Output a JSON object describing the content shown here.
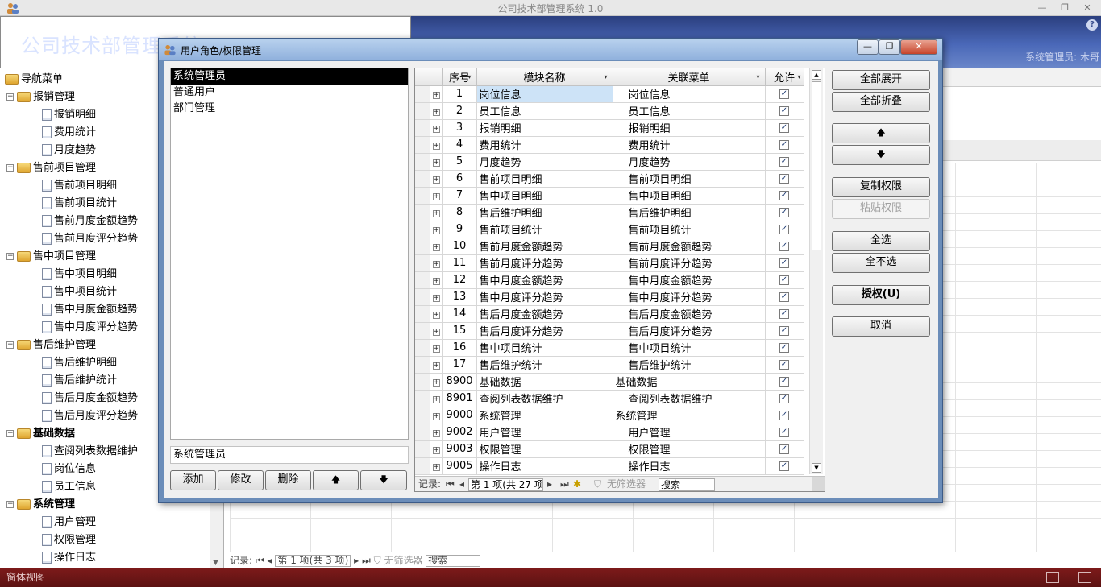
{
  "app": {
    "title": "公司技术部管理系统 1.0",
    "banner_title": "公司技术部管理系统",
    "current_user": "系统管理员: 木哥",
    "help": "?"
  },
  "window_controls": {
    "minimize": "—",
    "restore": "❐",
    "close": "✕"
  },
  "nav": {
    "root": "导航菜单",
    "items": [
      {
        "type": "folder",
        "label": "报销管理",
        "level": 1
      },
      {
        "type": "doc",
        "label": "报销明细",
        "level": 2
      },
      {
        "type": "doc",
        "label": "费用统计",
        "level": 2
      },
      {
        "type": "doc",
        "label": "月度趋势",
        "level": 2
      },
      {
        "type": "folder",
        "label": "售前项目管理",
        "level": 1
      },
      {
        "type": "doc",
        "label": "售前项目明细",
        "level": 2
      },
      {
        "type": "doc",
        "label": "售前项目统计",
        "level": 2
      },
      {
        "type": "doc",
        "label": "售前月度金额趋势",
        "level": 2
      },
      {
        "type": "doc",
        "label": "售前月度评分趋势",
        "level": 2
      },
      {
        "type": "folder",
        "label": "售中项目管理",
        "level": 1
      },
      {
        "type": "doc",
        "label": "售中项目明细",
        "level": 2
      },
      {
        "type": "doc",
        "label": "售中项目统计",
        "level": 2
      },
      {
        "type": "doc",
        "label": "售中月度金额趋势",
        "level": 2
      },
      {
        "type": "doc",
        "label": "售中月度评分趋势",
        "level": 2
      },
      {
        "type": "folder",
        "label": "售后维护管理",
        "level": 1
      },
      {
        "type": "doc",
        "label": "售后维护明细",
        "level": 2
      },
      {
        "type": "doc",
        "label": "售后维护统计",
        "level": 2
      },
      {
        "type": "doc",
        "label": "售后月度金额趋势",
        "level": 2
      },
      {
        "type": "doc",
        "label": "售后月度评分趋势",
        "level": 2
      },
      {
        "type": "folder",
        "label": "基础数据",
        "level": 1
      },
      {
        "type": "doc",
        "label": "查阅列表数据维护",
        "level": 2
      },
      {
        "type": "doc",
        "label": "岗位信息",
        "level": 2
      },
      {
        "type": "doc",
        "label": "员工信息",
        "level": 2
      },
      {
        "type": "folder",
        "label": "系统管理",
        "level": 1
      },
      {
        "type": "doc",
        "label": "用户管理",
        "level": 2
      },
      {
        "type": "doc",
        "label": "权限管理",
        "level": 2
      },
      {
        "type": "doc",
        "label": "操作日志",
        "level": 2
      }
    ]
  },
  "background_grid": {
    "record_label": "记录:",
    "record_position": "第 1 项(共 3 项)",
    "filter_label": "无筛选器",
    "search_label": "搜索"
  },
  "statusbar": {
    "text": "窗体视图"
  },
  "dialog": {
    "title": "用户角色/权限管理",
    "roles": [
      "系统管理员",
      "普通用户",
      "部门管理"
    ],
    "selected_role_index": 0,
    "role_input_value": "系统管理员",
    "role_buttons": {
      "add": "添加",
      "edit": "修改",
      "delete": "删除",
      "up": "🡅",
      "down": "🡇"
    },
    "grid": {
      "columns": {
        "seq": "序号",
        "module": "模块名称",
        "menu": "关联菜单",
        "allow": "允许"
      },
      "rows": [
        {
          "seq": "1",
          "module": "岗位信息",
          "menu": "岗位信息",
          "allow": true,
          "indent": true
        },
        {
          "seq": "2",
          "module": "员工信息",
          "menu": "员工信息",
          "allow": true,
          "indent": true
        },
        {
          "seq": "3",
          "module": "报销明细",
          "menu": "报销明细",
          "allow": true,
          "indent": true
        },
        {
          "seq": "4",
          "module": "费用统计",
          "menu": "费用统计",
          "allow": true,
          "indent": true
        },
        {
          "seq": "5",
          "module": "月度趋势",
          "menu": "月度趋势",
          "allow": true,
          "indent": true
        },
        {
          "seq": "6",
          "module": "售前项目明细",
          "menu": "售前项目明细",
          "allow": true,
          "indent": true
        },
        {
          "seq": "7",
          "module": "售中项目明细",
          "menu": "售中项目明细",
          "allow": true,
          "indent": true
        },
        {
          "seq": "8",
          "module": "售后维护明细",
          "menu": "售后维护明细",
          "allow": true,
          "indent": true
        },
        {
          "seq": "9",
          "module": "售前项目统计",
          "menu": "售前项目统计",
          "allow": true,
          "indent": true
        },
        {
          "seq": "10",
          "module": "售前月度金额趋势",
          "menu": "售前月度金额趋势",
          "allow": true,
          "indent": true
        },
        {
          "seq": "11",
          "module": "售前月度评分趋势",
          "menu": "售前月度评分趋势",
          "allow": true,
          "indent": true
        },
        {
          "seq": "12",
          "module": "售中月度金额趋势",
          "menu": "售中月度金额趋势",
          "allow": true,
          "indent": true
        },
        {
          "seq": "13",
          "module": "售中月度评分趋势",
          "menu": "售中月度评分趋势",
          "allow": true,
          "indent": true
        },
        {
          "seq": "14",
          "module": "售后月度金额趋势",
          "menu": "售后月度金额趋势",
          "allow": true,
          "indent": true
        },
        {
          "seq": "15",
          "module": "售后月度评分趋势",
          "menu": "售后月度评分趋势",
          "allow": true,
          "indent": true
        },
        {
          "seq": "16",
          "module": "售中项目统计",
          "menu": "售中项目统计",
          "allow": true,
          "indent": true
        },
        {
          "seq": "17",
          "module": "售后维护统计",
          "menu": "售后维护统计",
          "allow": true,
          "indent": true
        },
        {
          "seq": "8900",
          "module": "基础数据",
          "menu": "基础数据",
          "allow": true,
          "indent": false
        },
        {
          "seq": "8901",
          "module": "查阅列表数据维护",
          "menu": "查阅列表数据维护",
          "allow": true,
          "indent": true
        },
        {
          "seq": "9000",
          "module": "系统管理",
          "menu": "系统管理",
          "allow": true,
          "indent": false
        },
        {
          "seq": "9002",
          "module": "用户管理",
          "menu": "用户管理",
          "allow": true,
          "indent": true
        },
        {
          "seq": "9003",
          "module": "权限管理",
          "menu": "权限管理",
          "allow": true,
          "indent": true
        },
        {
          "seq": "9005",
          "module": "操作日志",
          "menu": "操作日志",
          "allow": true,
          "indent": true
        }
      ],
      "nav": {
        "record_label": "记录:",
        "record_position": "第 1 项(共 27 项",
        "filter_label": "无筛选器",
        "search_label": "搜索"
      }
    },
    "actions": {
      "expand_all": "全部展开",
      "collapse_all": "全部折叠",
      "move_up": "🡅",
      "move_down": "🡇",
      "copy_perm": "复制权限",
      "paste_perm": "粘贴权限",
      "select_all": "全选",
      "select_none": "全不选",
      "grant": "授权(U)",
      "cancel": "取消"
    }
  }
}
